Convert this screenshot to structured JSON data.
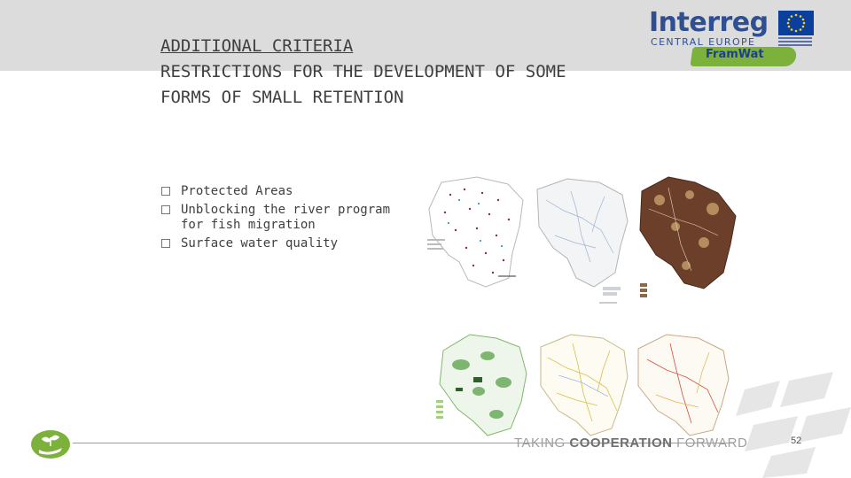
{
  "slide": {
    "title_line1": "ADDITIONAL CRITERIA",
    "title_line2": "RESTRICTIONS FOR THE DEVELOPMENT OF SOME",
    "title_line3": "FORMS OF SMALL RETENTION",
    "bullets": [
      "Protected Areas",
      "Unblocking the river program for fish migration",
      "Surface water quality"
    ],
    "footer_text_a": "TAKING ",
    "footer_text_b": "COOPERATION",
    "footer_text_c": " FORWARD",
    "page_number": "52"
  },
  "logo": {
    "brand": "Interreg",
    "region": "CENTRAL EUROPE",
    "project": "FramWat"
  },
  "colors": {
    "top_band": "#dcdcdc",
    "brand_blue": "#2f4f93",
    "project_green": "#7cb13b",
    "map_brown": "#6b3f2a"
  },
  "icons": {
    "bullet": "checkbox-square-icon",
    "footer_logo": "hand-plant-icon"
  }
}
